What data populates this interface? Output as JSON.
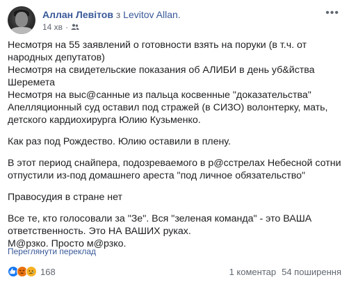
{
  "post": {
    "author": "Аллан Левітов",
    "via": "з",
    "group": "Levitov Allan.",
    "time": "14 хв",
    "dot": "·",
    "privacy_icon": "friends-icon",
    "more_icon": "more-options-icon",
    "paragraphs": [
      {
        "lines": [
          "Несмотря на 55 заявлений о готовности взять на поруки (в т.ч. от",
          "народных депутатов)",
          "Несмотря на свидетельские показания об АЛИБИ в день уб&йства",
          "Шеремета",
          "Несмотря на выс@санные из пальца косвенные \"доказательства\"",
          "Апелляционный суд оставил под стражей (в СИЗО) волонтерку, мать,",
          "детского кардиохирурга Юлию Кузьменко."
        ]
      },
      {
        "lines": [
          "Как раз под Рождество. Юлию оставили в плену."
        ]
      },
      {
        "lines": [
          "В этот период снайпера, подозреваемого в р@сстрелах Небесной сотни",
          "отпустили из-под домашнего ареста \"под личное обязательство\""
        ]
      },
      {
        "lines": [
          "Правосудия в стране нет"
        ]
      },
      {
        "lines": [
          "Все те, кто голосовали за \"Зе\". Вся \"зеленая команда\" - это ВАША",
          "ответственность. Это НА ВАШИХ руках.",
          "М@рзко. Просто м@рзко."
        ]
      }
    ],
    "translate_link": "Переглянути переклад"
  },
  "stats": {
    "reactions": [
      "like",
      "angry",
      "sad"
    ],
    "reaction_count": "168",
    "comments": "1 коментар",
    "shares": "54 поширення"
  },
  "colors": {
    "link": "#385898",
    "secondary": "#616770",
    "text": "#1c1e21"
  }
}
